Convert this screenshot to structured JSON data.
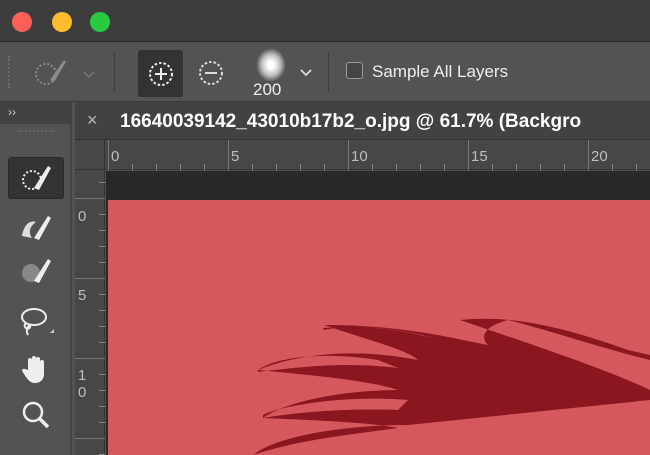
{
  "window": {
    "controls": [
      "close",
      "minimize",
      "zoom"
    ]
  },
  "options_bar": {
    "brush_size": "200",
    "sample_all_layers_label": "Sample All Layers",
    "sample_all_layers_checked": false
  },
  "panel": {
    "collapse_label": "››"
  },
  "document": {
    "tab_title": "16640039142_43010b17b2_o.jpg @ 61.7% (Backgro",
    "close_label": "×"
  },
  "ruler_top": [
    "0",
    "5",
    "10",
    "15",
    "20"
  ],
  "ruler_left": [
    "0",
    "5",
    "1",
    "0"
  ],
  "colors": {
    "overlay": "#d5585e",
    "subject": "#8b1620"
  }
}
